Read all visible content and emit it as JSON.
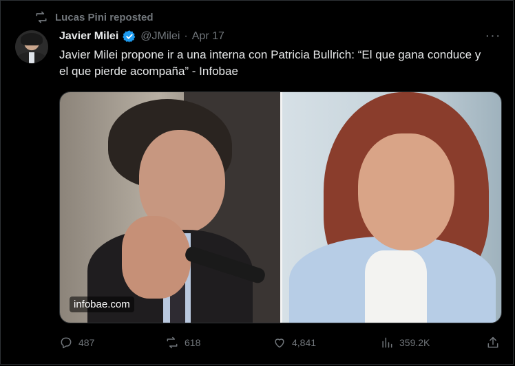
{
  "social_context": {
    "text": "Lucas Pini reposted",
    "icon": "repost-icon"
  },
  "author": {
    "name": "Javier Milei",
    "verified_icon": "verified-badge-icon",
    "handle": "@JMilei",
    "separator": "·",
    "date": "Apr 17"
  },
  "more_icon": "more-icon",
  "tweet": {
    "text": "Javier Milei propone ir a una interna con Patricia Bullrich: “El que gana conduce y el que pierde acompaña” - Infobae"
  },
  "media": {
    "watermark": "infobae.com"
  },
  "actions": {
    "replies": "487",
    "reposts": "618",
    "likes": "4,841",
    "views": "359.2K"
  },
  "colors": {
    "background": "#000000",
    "text_primary": "#e7e9ea",
    "text_secondary": "#71767b",
    "verified": "#1d9bf0",
    "border": "#2f3336"
  }
}
